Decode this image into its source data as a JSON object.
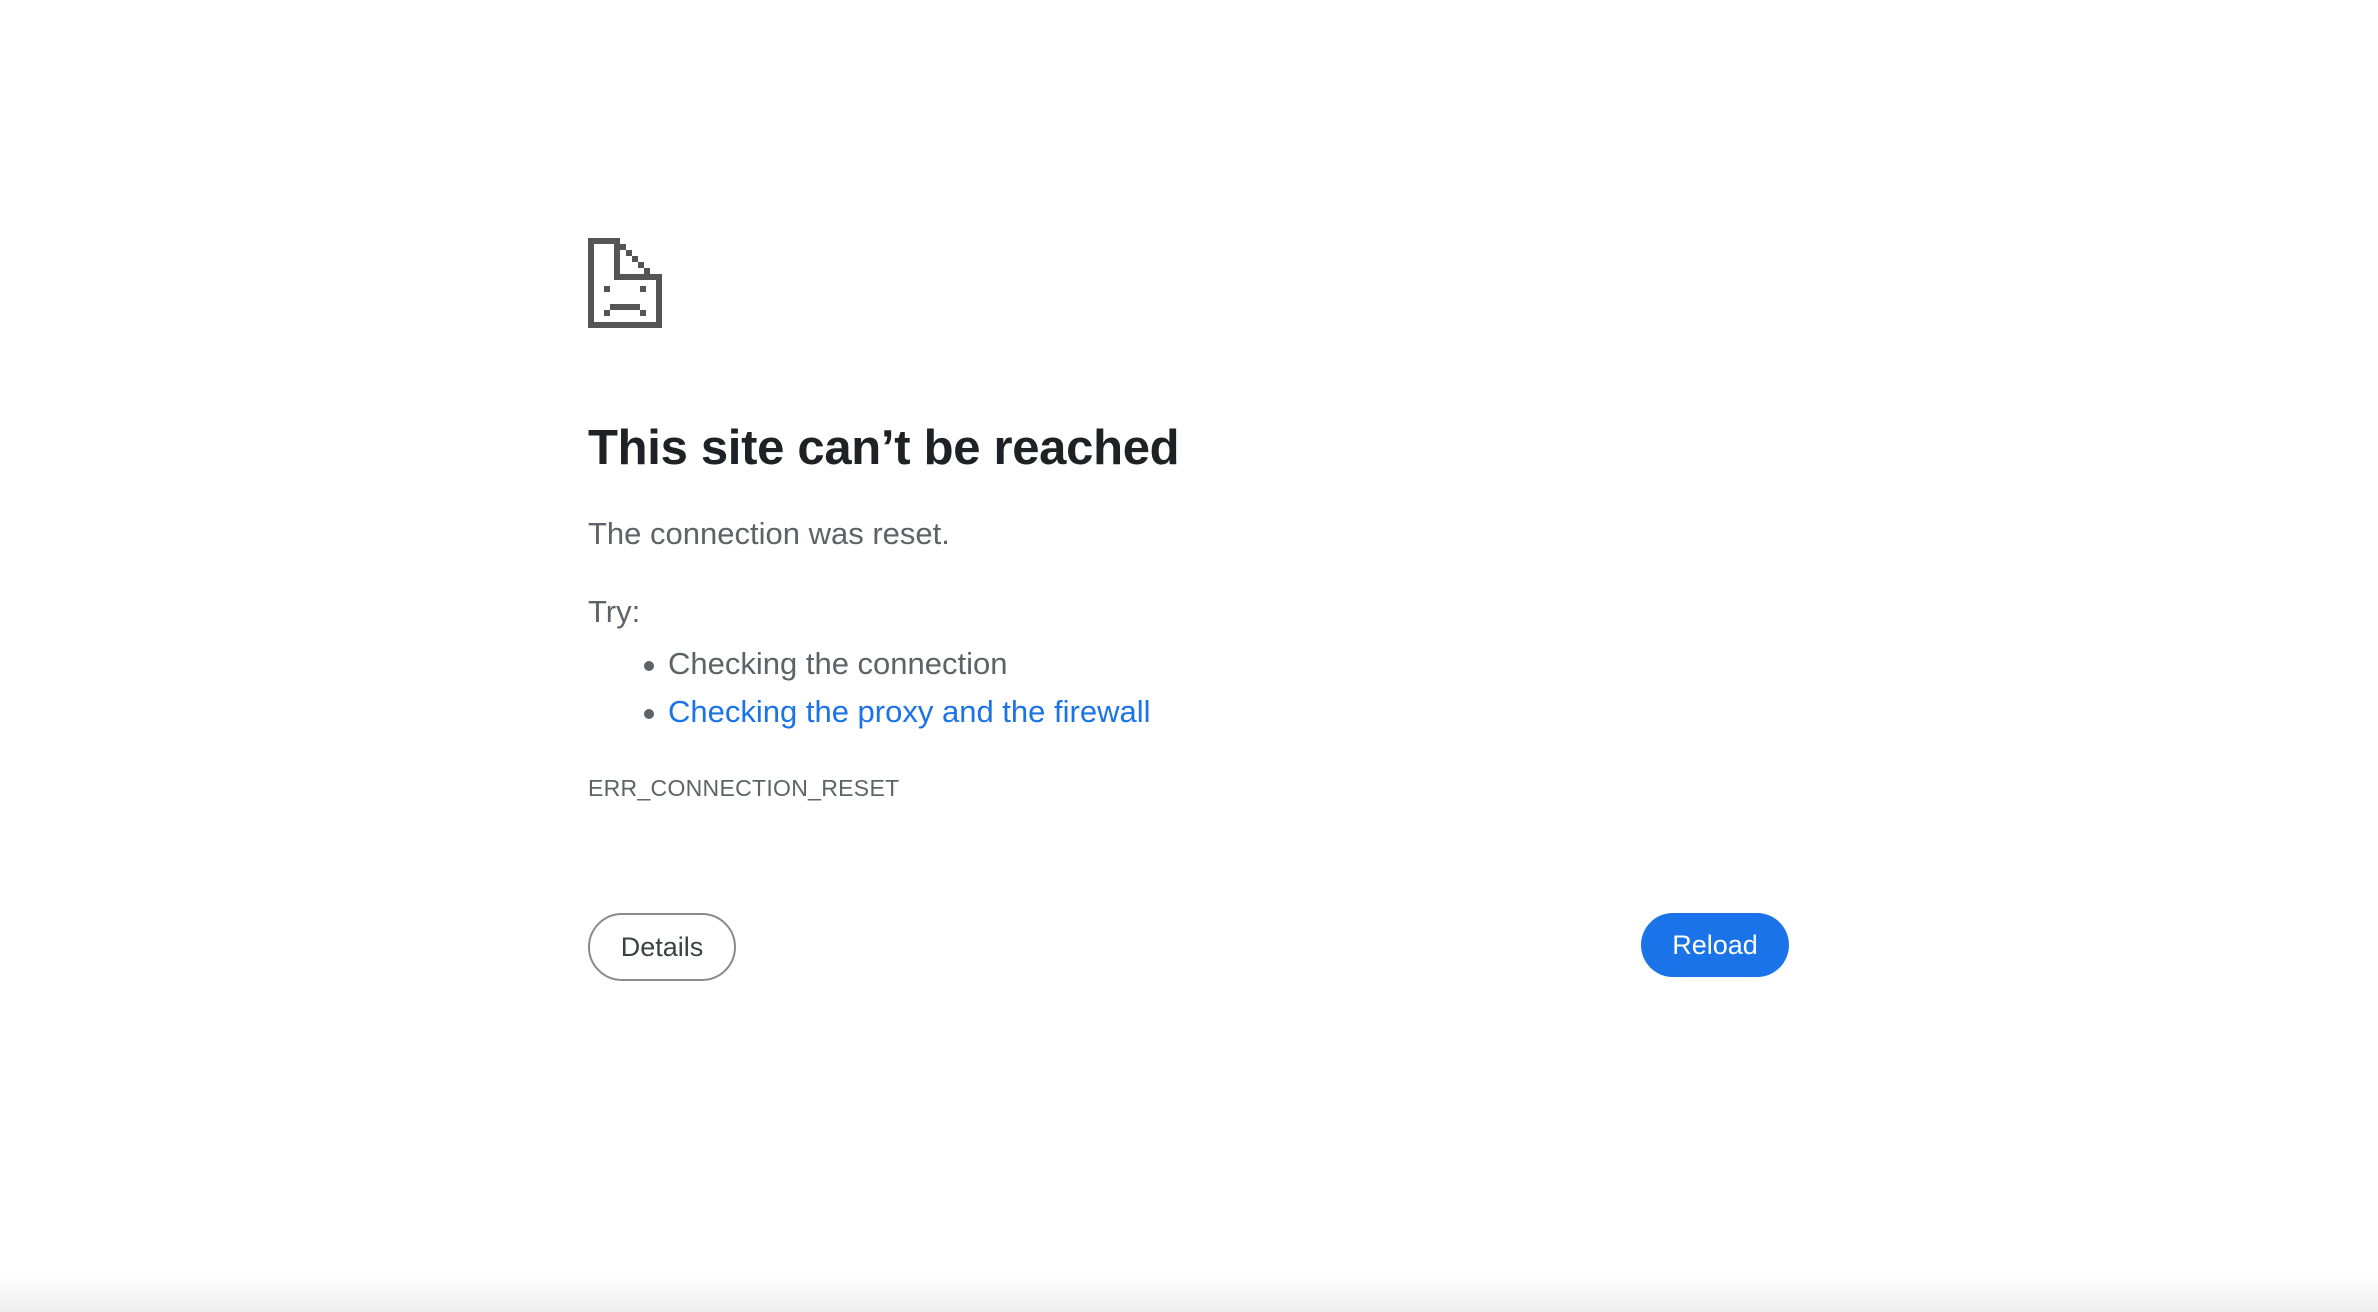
{
  "error_page": {
    "icon": "sad-page-icon",
    "title": "This site can’t be reached",
    "description": "The connection was reset.",
    "try_label": "Try:",
    "suggestions": [
      {
        "text": "Checking the connection",
        "link": false
      },
      {
        "text": "Checking the proxy and the firewall",
        "link": true
      }
    ],
    "error_code": "ERR_CONNECTION_RESET",
    "buttons": {
      "details_label": "Details",
      "reload_label": "Reload"
    }
  },
  "colors": {
    "title": "#202124",
    "body_text": "#5f6368",
    "link": "#1a73e8",
    "primary_button": "#1a73e8",
    "icon": "#555555"
  }
}
